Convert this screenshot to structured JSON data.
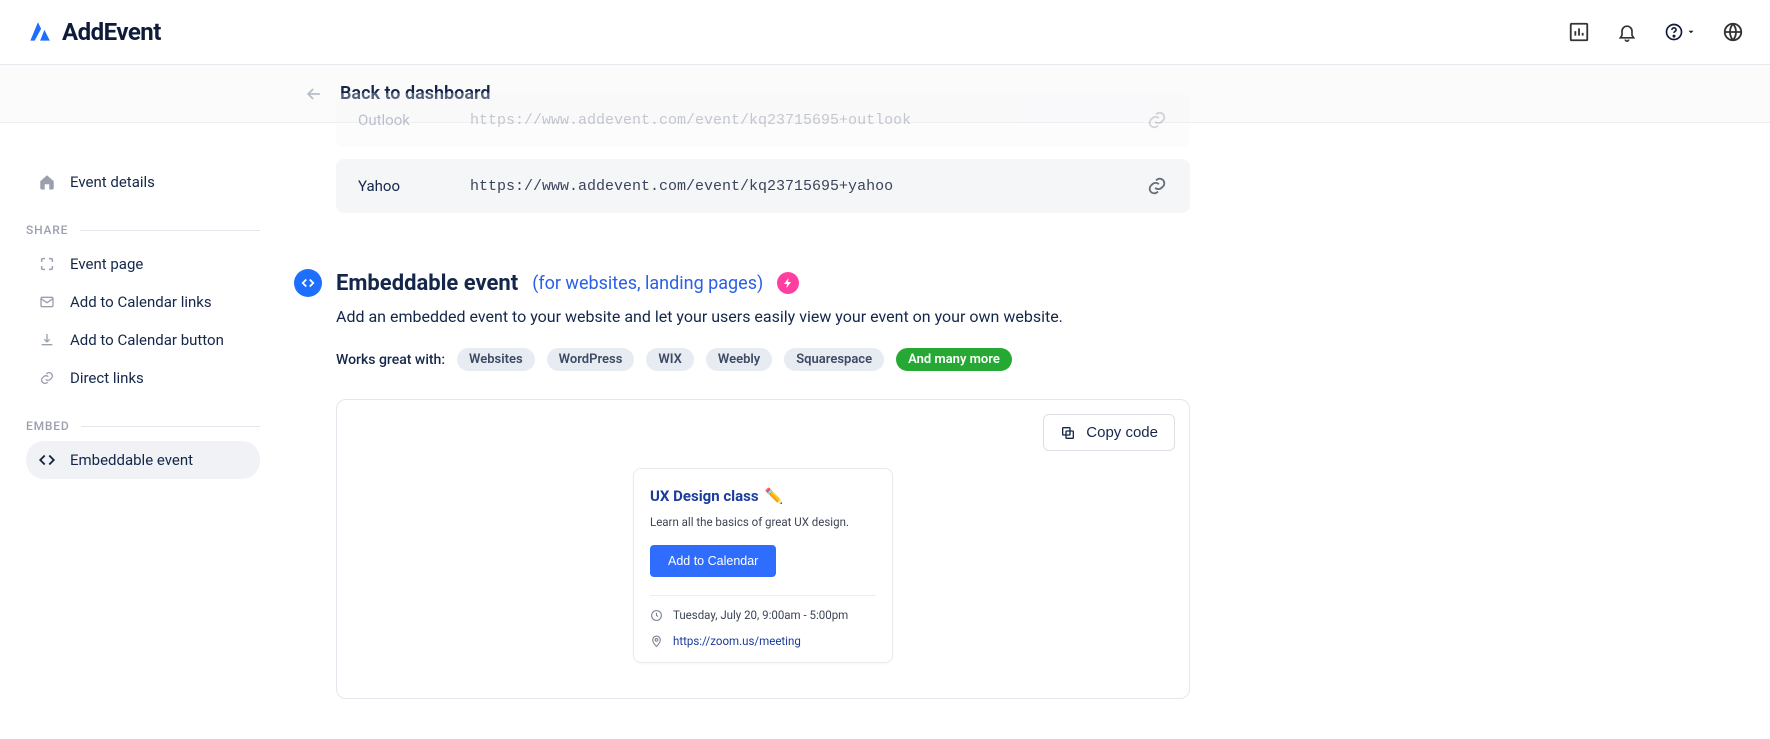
{
  "brand": {
    "name": "AddEvent"
  },
  "back": {
    "label": "Back to dashboard"
  },
  "sidebar": {
    "event_details": "Event details",
    "share_label": "SHARE",
    "share_items": [
      {
        "label": "Event page"
      },
      {
        "label": "Add to Calendar links"
      },
      {
        "label": "Add to Calendar button"
      },
      {
        "label": "Direct links"
      }
    ],
    "embed_label": "EMBED",
    "embed_items": [
      {
        "label": "Embeddable event"
      }
    ]
  },
  "links": [
    {
      "provider": "Outlook",
      "url": "https://www.addevent.com/event/kq23715695+outlook"
    },
    {
      "provider": "Yahoo",
      "url": "https://www.addevent.com/event/kq23715695+yahoo"
    }
  ],
  "section": {
    "title": "Embeddable event",
    "subtitle": "(for websites, landing pages)",
    "desc": "Add an embedded event to your website and let your users easily view your event on your own website.",
    "works_label": "Works great with:",
    "chips": [
      "Websites",
      "WordPress",
      "WIX",
      "Weebly",
      "Squarespace"
    ],
    "chip_more": "And many more"
  },
  "preview": {
    "copy_label": "Copy code",
    "event": {
      "title": "UX Design class",
      "emoji": "✏️",
      "desc": "Learn all the basics of great UX design.",
      "button": "Add to Calendar",
      "time": "Tuesday, July 20, 9:00am - 5:00pm",
      "location": "https://zoom.us/meeting"
    }
  }
}
